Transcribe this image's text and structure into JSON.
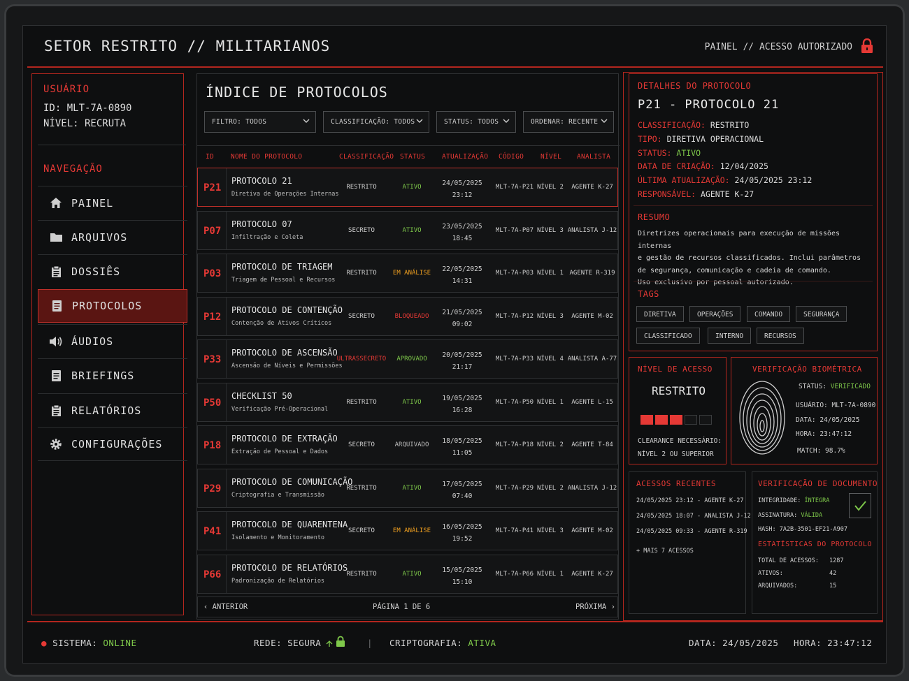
{
  "header": {
    "title": "SETOR RESTRITO // MILITARIANOS",
    "access": "PAINEL // ACESSO AUTORIZADO"
  },
  "user": {
    "label": "USUÁRIO",
    "id": "ID: MLT-7A-0890",
    "level": "NÍVEL: RECRUTA"
  },
  "nav": {
    "label": "NAVEGAÇÃO",
    "items": [
      {
        "label": "PAINEL",
        "icon": "home-icon"
      },
      {
        "label": "ARQUIVOS",
        "icon": "folder-icon"
      },
      {
        "label": "DOSSIÊS",
        "icon": "clipboard-icon"
      },
      {
        "label": "PROTOCOLOS",
        "icon": "document-icon"
      },
      {
        "label": "ÁUDIOS",
        "icon": "speaker-icon"
      },
      {
        "label": "BRIEFINGS",
        "icon": "document-icon"
      },
      {
        "label": "RELATÓRIOS",
        "icon": "clipboard-icon"
      },
      {
        "label": "CONFIGURAÇÕES",
        "icon": "gear-icon"
      }
    ],
    "active": "PROTOCOLOS"
  },
  "index": {
    "title": "ÍNDICE DE PROTOCOLOS",
    "filters": [
      "FILTRO: TODOS",
      "CLASSIFICAÇÃO: TODOS",
      "STATUS: TODOS",
      "ORDENAR: RECENTE"
    ],
    "columns": [
      "ID",
      "NOME DO PROTOCOLO",
      "CLASSIFICAÇÃO",
      "STATUS",
      "ATUALIZAÇÃO",
      "CÓDIGO",
      "NÍVEL",
      "ANALISTA"
    ],
    "rows": [
      {
        "id": "P21",
        "name": "PROTOCOLO 21",
        "sub": "Diretiva de Operações Internas",
        "class": "RESTRITO",
        "status": "ATIVO",
        "date": "24/05/2025",
        "time": "23:12",
        "code": "MLT-7A-P21",
        "level": "NÍVEL 2",
        "analyst": "AGENTE K-27"
      },
      {
        "id": "P07",
        "name": "PROTOCOLO 07",
        "sub": "Infiltração e Coleta",
        "class": "SECRETO",
        "status": "ATIVO",
        "date": "23/05/2025",
        "time": "18:45",
        "code": "MLT-7A-P07",
        "level": "NÍVEL 3",
        "analyst": "ANALISTA J-12"
      },
      {
        "id": "P03",
        "name": "PROTOCOLO DE TRIAGEM",
        "sub": "Triagem de Pessoal e Recursos",
        "class": "RESTRITO",
        "status": "EM ANÁLISE",
        "date": "22/05/2025",
        "time": "14:31",
        "code": "MLT-7A-P03",
        "level": "NÍVEL 1",
        "analyst": "AGENTE R-319"
      },
      {
        "id": "P12",
        "name": "PROTOCOLO DE CONTENÇÃO",
        "sub": "Contenção de Ativos Críticos",
        "class": "SECRETO",
        "status": "BLOQUEADO",
        "date": "21/05/2025",
        "time": "09:02",
        "code": "MLT-7A-P12",
        "level": "NÍVEL 3",
        "analyst": "AGENTE M-02"
      },
      {
        "id": "P33",
        "name": "PROTOCOLO DE ASCENSÃO",
        "sub": "Ascensão de Níveis e Permissões",
        "class": "ULTRASSECRETO",
        "status": "APROVADO",
        "date": "20/05/2025",
        "time": "21:17",
        "code": "MLT-7A-P33",
        "level": "NÍVEL 4",
        "analyst": "ANALISTA A-77"
      },
      {
        "id": "P50",
        "name": "CHECKLIST 50",
        "sub": "Verificação Pré-Operacional",
        "class": "RESTRITO",
        "status": "ATIVO",
        "date": "19/05/2025",
        "time": "16:28",
        "code": "MLT-7A-P50",
        "level": "NÍVEL 1",
        "analyst": "AGENTE L-15"
      },
      {
        "id": "P18",
        "name": "PROTOCOLO DE EXTRAÇÃO",
        "sub": "Extração de Pessoal e Dados",
        "class": "SECRETO",
        "status": "ARQUIVADO",
        "date": "18/05/2025",
        "time": "11:05",
        "code": "MLT-7A-P18",
        "level": "NÍVEL 2",
        "analyst": "AGENTE T-84"
      },
      {
        "id": "P29",
        "name": "PROTOCOLO DE COMUNICAÇÃO",
        "sub": "Criptografia e Transmissão",
        "class": "RESTRITO",
        "status": "ATIVO",
        "date": "17/05/2025",
        "time": "07:40",
        "code": "MLT-7A-P29",
        "level": "NÍVEL 2",
        "analyst": "ANALISTA J-12"
      },
      {
        "id": "P41",
        "name": "PROTOCOLO DE QUARENTENA",
        "sub": "Isolamento e Monitoramento",
        "class": "SECRETO",
        "status": "EM ANÁLISE",
        "date": "16/05/2025",
        "time": "19:52",
        "code": "MLT-7A-P41",
        "level": "NÍVEL 3",
        "analyst": "AGENTE M-02"
      },
      {
        "id": "P66",
        "name": "PROTOCOLO DE RELATÓRIOS",
        "sub": "Padronização de Relatórios",
        "class": "RESTRITO",
        "status": "ATIVO",
        "date": "15/05/2025",
        "time": "15:10",
        "code": "MLT-7A-P66",
        "level": "NÍVEL 1",
        "analyst": "AGENTE K-27"
      }
    ],
    "prev": "ANTERIOR",
    "page": "PÁGINA 1 DE 6",
    "next": "PRÓXIMA"
  },
  "details": {
    "heading": "DETALHES DO PROTOCOLO",
    "title": "P21 - PROTOCOLO 21",
    "fields": [
      {
        "k": "CLASSIFICAÇÃO:",
        "v": "RESTRITO"
      },
      {
        "k": "TIPO:",
        "v": "DIRETIVA OPERACIONAL"
      },
      {
        "k": "STATUS:",
        "v": "ATIVO"
      },
      {
        "k": "DATA DE CRIAÇÃO:",
        "v": "12/04/2025"
      },
      {
        "k": "ÚLTIMA ATUALIZAÇÃO:",
        "v": "24/05/2025 23:12"
      },
      {
        "k": "RESPONSÁVEL:",
        "v": " AGENTE K-27"
      }
    ],
    "summary_label": "RESUMO",
    "summary": [
      "Diretrizes operacionais para execução de missões internas",
      "e gestão de recursos classificados. Inclui parâmetros",
      "de segurança, comunicação e cadeia de comando.",
      "Uso exclusivo por pessoal autorizado."
    ],
    "tags_label": "TAGS",
    "tags": [
      "DIRETIVA",
      "OPERAÇÕES",
      "COMANDO",
      "SEGURANÇA",
      "CLASSIFICADO",
      "INTERNO",
      "RECURSOS"
    ]
  },
  "access_level": {
    "heading": "NÍVEL DE ACESSO",
    "value": "RESTRITO",
    "filled": 3,
    "total": 5,
    "note1": "CLEARANCE NECESSÁRIO:",
    "note2": "NÍVEL 2 OU SUPERIOR"
  },
  "biometric": {
    "heading": "VERIFICAÇÃO BIOMÉTRICA",
    "status_k": "STATUS:",
    "status_v": "VERIFICADO",
    "user": "USUÁRIO: MLT-7A-0890",
    "date": "DATA: 24/05/2025",
    "time": "HORA: 23:47:12",
    "match": "MATCH: 98.7%"
  },
  "recent": {
    "heading": "ACESSOS RECENTES",
    "items": [
      "24/05/2025 23:12 - AGENTE K-27",
      "24/05/2025 18:07 - ANALISTA J-12",
      "24/05/2025 09:33 - AGENTE R-319"
    ],
    "more": "+ MAIS 7 ACESSOS"
  },
  "docverify": {
    "heading": "VERIFICAÇÃO DE DOCUMENTO",
    "integ_k": "INTEGRIDADE:",
    "integ_v": "ÍNTEGRA",
    "sig_k": "ASSINATURA:",
    "sig_v": "VÁLIDA",
    "hash": "HASH: 7A2B-3501-EF21-A907",
    "stats_heading": "ESTATÍSTICAS DO PROTOCOLO",
    "stats": [
      {
        "k": "TOTAL DE ACESSOS:",
        "v": "1287"
      },
      {
        "k": "ATIVOS:",
        "v": "42"
      },
      {
        "k": "ARQUIVADOS:",
        "v": "15"
      }
    ]
  },
  "footer": {
    "system_k": "SISTEMA:",
    "system_v": "ONLINE",
    "network": "REDE: SEGURA",
    "crypto_k": "CRIPTOGRAFIA:",
    "crypto_v": "ATIVA",
    "date": "DATA: 24/05/2025",
    "time": "HORA: 23:47:12"
  },
  "colors": {
    "accent": "#e53935",
    "ok": "#7ec84a",
    "warn": "#f0a020",
    "panel": "#0e0f10"
  }
}
